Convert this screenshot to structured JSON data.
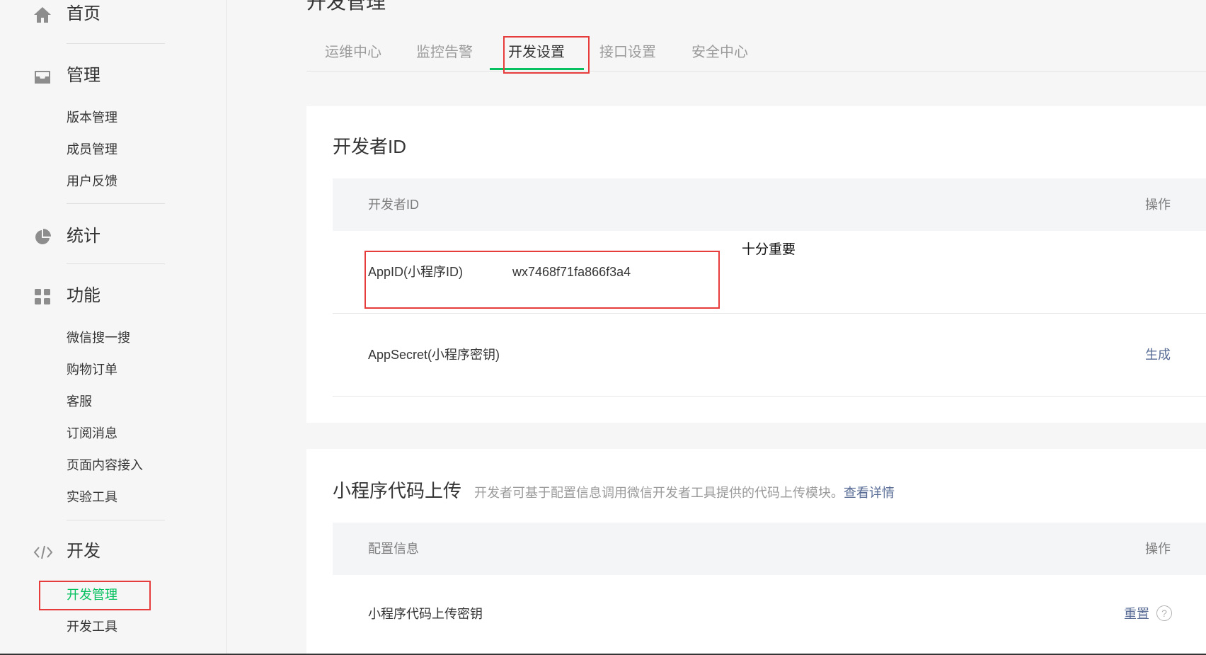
{
  "sidebar": {
    "home": "首页",
    "manage": {
      "label": "管理",
      "items": [
        "版本管理",
        "成员管理",
        "用户反馈"
      ]
    },
    "stats": {
      "label": "统计"
    },
    "features": {
      "label": "功能",
      "items": [
        "微信搜一搜",
        "购物订单",
        "客服",
        "订阅消息",
        "页面内容接入",
        "实验工具"
      ]
    },
    "dev": {
      "label": "开发",
      "items": [
        "开发管理",
        "开发工具"
      ],
      "active": "开发管理"
    },
    "icons": {
      "home": "home-icon",
      "manage": "inbox-icon",
      "stats": "pie-chart-icon",
      "features": "grid-icon",
      "dev": "code-icon"
    }
  },
  "page": {
    "title": "开发管理"
  },
  "tabs": [
    "运维中心",
    "监控告警",
    "开发设置",
    "接口设置",
    "安全中心"
  ],
  "active_tab": "开发设置",
  "developer_id": {
    "title": "开发者ID",
    "col_left": "开发者ID",
    "col_right": "操作",
    "rows": [
      {
        "label": "AppID(小程序ID)",
        "value": "wx7468f71fa866f3a4",
        "action": ""
      },
      {
        "label": "AppSecret(小程序密钥)",
        "value": "",
        "action": "生成"
      }
    ],
    "annotation": "十分重要"
  },
  "upload": {
    "title": "小程序代码上传",
    "desc": "开发者可基于配置信息调用微信开发者工具提供的代码上传模块。",
    "desc_link": "查看详情",
    "col_left": "配置信息",
    "col_right": "操作",
    "rows": [
      {
        "label": "小程序代码上传密钥",
        "action": "重置",
        "help": "?"
      }
    ]
  },
  "colors": {
    "accent": "#07c160",
    "link": "#576b95",
    "highlight": "#e63c3c"
  }
}
